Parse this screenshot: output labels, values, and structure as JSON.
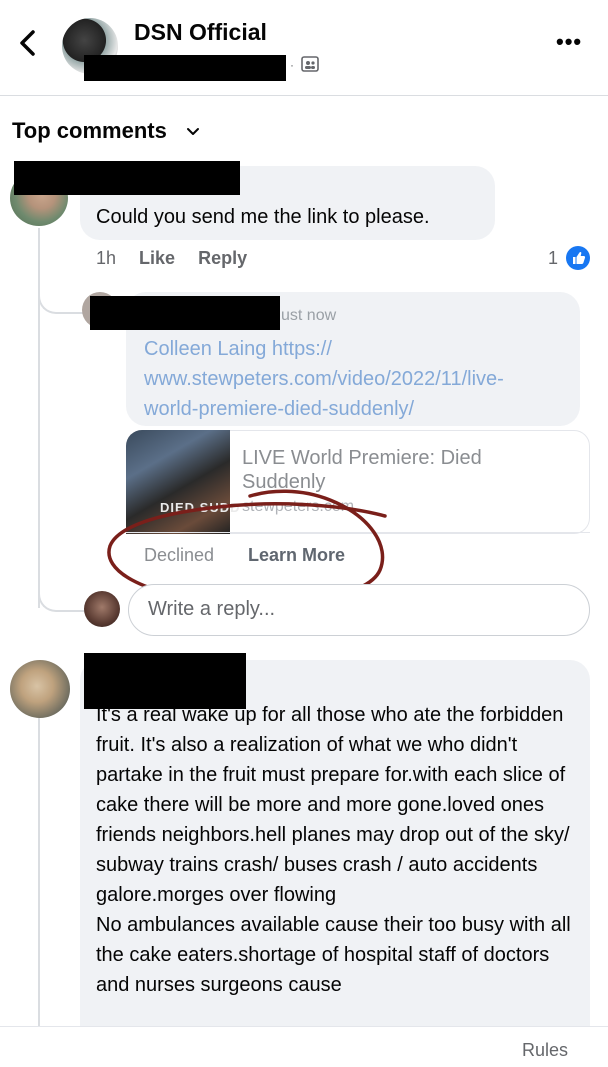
{
  "header": {
    "title": "DSN Official",
    "separator": "·",
    "back_icon": "chevron-left-icon",
    "more_icon": "more-horizontal-icon",
    "more_label": "•••",
    "audience_icon": "group-audience-icon"
  },
  "comments_filter": {
    "label": "Top comments",
    "icon": "chevron-down-icon"
  },
  "comments": [
    {
      "text": "Could you send me the link to please.",
      "time": "1h",
      "like_label": "Like",
      "reply_label": "Reply",
      "reaction_count": "1",
      "reaction_icon": "like-icon",
      "replies": [
        {
          "time": "ust now",
          "text": "Colleen Laing https://\nwww.stewpeters.com/video/2022/11/live-\nworld-premiere-died-suddenly/",
          "link_preview": {
            "title": "LIVE World Premiere: Died Suddenly",
            "domain": "stewpeters.com",
            "thumbnail_text": "DIED SUDD",
            "status": "Declined",
            "action_label": "Learn More"
          }
        }
      ],
      "reply_input": {
        "placeholder": "Write a reply..."
      }
    },
    {
      "text": "It's a real wake up for all those who ate the forbidden fruit. It's also a realization of what we who didn't partake in the fruit must prepare for.with each slice of cake there will be more and more gone.loved ones friends neighbors.hell planes may drop out of the sky/ subway trains crash/ buses crash / auto accidents galore.morges over flowing\nNo ambulances available cause their too busy with all the cake eaters.shortage of hospital staff of doctors and nurses surgeons cause"
    }
  ],
  "footer": {
    "rules_label": "Rules"
  },
  "colors": {
    "bubble": "#f0f2f5",
    "link_text": "#84a9d8",
    "like_blue": "#1877f2",
    "annotation": "#7a1f1a"
  }
}
